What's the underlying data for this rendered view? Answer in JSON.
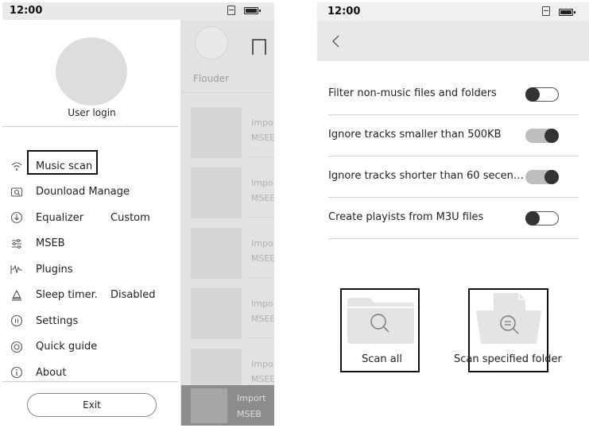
{
  "left_screen": {
    "status": {
      "time": "12:00"
    },
    "background": {
      "tab_label": "Flouder",
      "rows": [
        {
          "line1": "Impo",
          "line2": "MSEE"
        },
        {
          "line1": "Impo",
          "line2": "MSEE"
        },
        {
          "line1": "Impo",
          "line2": "MSEE"
        },
        {
          "line1": "Impo",
          "line2": "MSEE"
        },
        {
          "line1": "Impo",
          "line2": "MSEE"
        }
      ],
      "player": {
        "line1": "Import",
        "line2": "MSEB"
      }
    },
    "drawer": {
      "user_login": "User login",
      "menu": [
        {
          "icon": "wifi-scan-icon",
          "label": "Music scan",
          "value": ""
        },
        {
          "icon": "download-manage-icon",
          "label": "Dounload Manage",
          "value": ""
        },
        {
          "icon": "equalizer-icon",
          "label": "Equalizer",
          "value": "Custom"
        },
        {
          "icon": "mseb-sliders-icon",
          "label": "MSEB",
          "value": ""
        },
        {
          "icon": "plugins-icon",
          "label": "Plugins",
          "value": ""
        },
        {
          "icon": "sleep-timer-icon",
          "label": "Sleep timer.",
          "value": "Disabled"
        },
        {
          "icon": "settings-icon",
          "label": "Settings",
          "value": ""
        },
        {
          "icon": "quick-guide-icon",
          "label": "Quick guide",
          "value": ""
        },
        {
          "icon": "about-icon",
          "label": "About",
          "value": ""
        }
      ],
      "exit_label": "Exit"
    }
  },
  "right_screen": {
    "status": {
      "time": "12:00"
    },
    "settings": [
      {
        "label": "Filter non-music files and folders",
        "enabled": false
      },
      {
        "label": "Ignore tracks smaller than 500KB",
        "enabled": true
      },
      {
        "label": "Ignore tracks shorter than 60 secen…",
        "enabled": true
      },
      {
        "label": "Create playists from M3U files",
        "enabled": false
      }
    ],
    "scan_all_label": "Scan all",
    "scan_folder_label": "Scan specified folder"
  }
}
